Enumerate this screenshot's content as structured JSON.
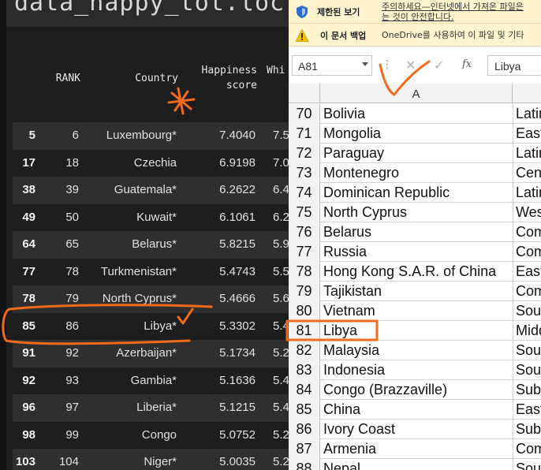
{
  "jupyter": {
    "code_text": "data_happy_tot.loc",
    "headers": {
      "rank": "RANK",
      "country": "Country",
      "happiness_line1": "Happiness",
      "happiness_line2": "score",
      "truncated": "Whi"
    },
    "rows": [
      {
        "idx": "5",
        "rank": "6",
        "country": "Luxembourg*",
        "score": "7.4040",
        "trunc": "7.5"
      },
      {
        "idx": "17",
        "rank": "18",
        "country": "Czechia",
        "score": "6.9198",
        "trunc": "7.0"
      },
      {
        "idx": "38",
        "rank": "39",
        "country": "Guatemala*",
        "score": "6.2622",
        "trunc": "6.4"
      },
      {
        "idx": "49",
        "rank": "50",
        "country": "Kuwait*",
        "score": "6.1061",
        "trunc": "6.2"
      },
      {
        "idx": "64",
        "rank": "65",
        "country": "Belarus*",
        "score": "5.8215",
        "trunc": "5.9"
      },
      {
        "idx": "77",
        "rank": "78",
        "country": "Turkmenistan*",
        "score": "5.4743",
        "trunc": "5.5"
      },
      {
        "idx": "78",
        "rank": "79",
        "country": "North Cyprus*",
        "score": "5.4666",
        "trunc": "5.6"
      },
      {
        "idx": "85",
        "rank": "86",
        "country": "Libya*",
        "score": "5.3302",
        "trunc": "5.4"
      },
      {
        "idx": "91",
        "rank": "92",
        "country": "Azerbaijan*",
        "score": "5.1734",
        "trunc": "5.2"
      },
      {
        "idx": "92",
        "rank": "93",
        "country": "Gambia*",
        "score": "5.1636",
        "trunc": "5.4"
      },
      {
        "idx": "96",
        "rank": "97",
        "country": "Liberia*",
        "score": "5.1215",
        "trunc": "5.4"
      },
      {
        "idx": "98",
        "rank": "99",
        "country": "Congo",
        "score": "5.0752",
        "trunc": "5.2"
      },
      {
        "idx": "103",
        "rank": "104",
        "country": "Niger*",
        "score": "5.0035",
        "trunc": "5.2"
      }
    ]
  },
  "excel": {
    "protected_bar": {
      "title": "제한된 보기",
      "text_line1": "주의하세요—인터넷에서 가져온 파일은",
      "text_line2": "는 것이 안전합니다."
    },
    "backup_bar": {
      "title": "이 문서 백업",
      "text": "OneDrive를 사용하여 이 파일 및 기타"
    },
    "name_box": "A81",
    "formula_value": "Libya",
    "fx_label": "fx",
    "column_header": "A",
    "rows": [
      {
        "num": "70",
        "a": "Bolivia",
        "b": "Latin"
      },
      {
        "num": "71",
        "a": "Mongolia",
        "b": "East"
      },
      {
        "num": "72",
        "a": "Paraguay",
        "b": "Latin"
      },
      {
        "num": "73",
        "a": "Montenegro",
        "b": "Cent"
      },
      {
        "num": "74",
        "a": "Dominican Republic",
        "b": "Latin"
      },
      {
        "num": "75",
        "a": "North Cyprus",
        "b": "West"
      },
      {
        "num": "76",
        "a": "Belarus",
        "b": "Com"
      },
      {
        "num": "77",
        "a": "Russia",
        "b": "Com"
      },
      {
        "num": "78",
        "a": "Hong Kong S.A.R. of China",
        "b": "East"
      },
      {
        "num": "79",
        "a": "Tajikistan",
        "b": "Com"
      },
      {
        "num": "80",
        "a": "Vietnam",
        "b": "Sout"
      },
      {
        "num": "81",
        "a": "Libya",
        "b": "Midd"
      },
      {
        "num": "82",
        "a": "Malaysia",
        "b": "Sout"
      },
      {
        "num": "83",
        "a": "Indonesia",
        "b": "Sout"
      },
      {
        "num": "84",
        "a": "Congo (Brazzaville)",
        "b": "Sub"
      },
      {
        "num": "85",
        "a": "China",
        "b": "East"
      },
      {
        "num": "86",
        "a": "Ivory Coast",
        "b": "Sub"
      },
      {
        "num": "87",
        "a": "Armenia",
        "b": "Com"
      },
      {
        "num": "88",
        "a": "Nepal",
        "b": "Sout"
      }
    ]
  },
  "colors": {
    "annotation": "#f26a1b",
    "jupyter_bg": "#1e1e1e",
    "jupyter_odd_row": "#2f2f2f",
    "message_bar": "#fff4ce"
  }
}
